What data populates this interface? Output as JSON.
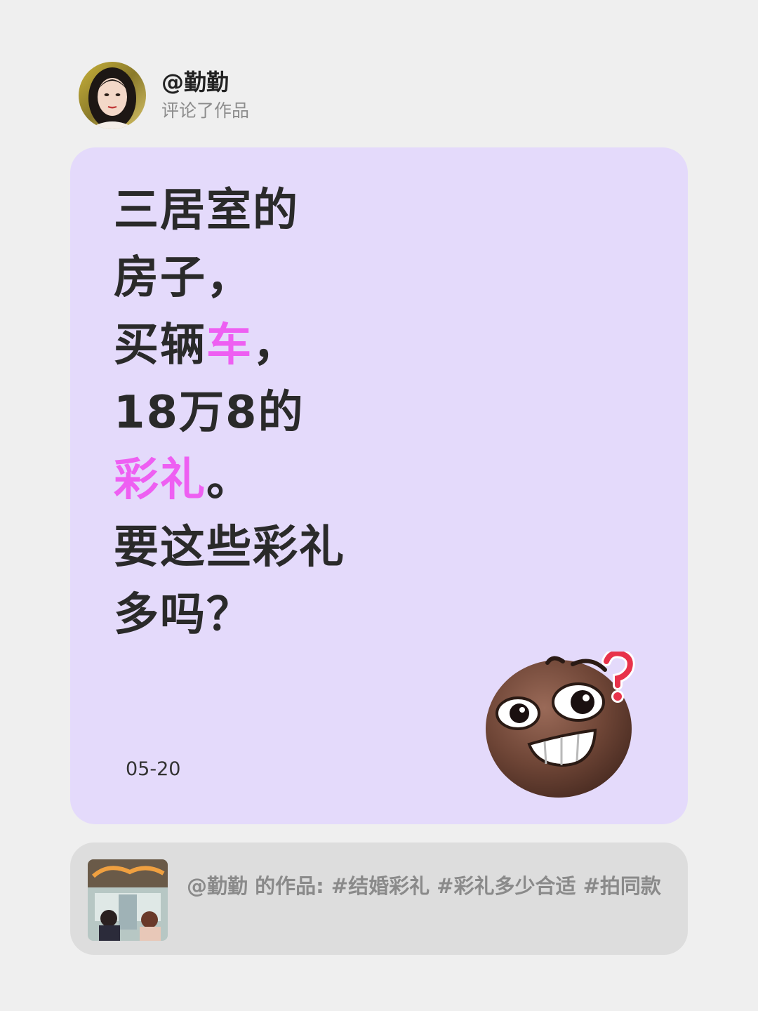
{
  "header": {
    "username": "@勤勤",
    "action": "评论了作品"
  },
  "comment": {
    "lines": [
      [
        {
          "text": "三居室的",
          "hl": false
        }
      ],
      [
        {
          "text": "房子，",
          "hl": false
        }
      ],
      [
        {
          "text": "买辆",
          "hl": false
        },
        {
          "text": "车",
          "hl": true
        },
        {
          "text": "，",
          "hl": false
        }
      ],
      [
        {
          "text": "18万8的",
          "hl": false
        }
      ],
      [
        {
          "text": "彩礼",
          "hl": true
        },
        {
          "text": "。",
          "hl": false
        }
      ],
      [
        {
          "text": "要这些彩礼",
          "hl": false
        }
      ],
      [
        {
          "text": "多吗？",
          "hl": false
        }
      ]
    ],
    "highlight_color": "#ee5ff2",
    "date": "05-20"
  },
  "sticker": {
    "icon": "confused-grin-face-emoji"
  },
  "work": {
    "text": "@勤勤  的作品: #结婚彩礼  #彩礼多少合适  #拍同款",
    "thumbnail_icon": "video-thumbnail"
  },
  "colors": {
    "background": "#efefef",
    "card": "#e4dafb",
    "work_bar": "#dddddd"
  }
}
